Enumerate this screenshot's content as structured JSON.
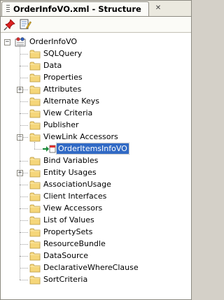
{
  "tab": {
    "title": "OrderInfoVO.xml - Structure"
  },
  "toolbar": {
    "pin_icon": "pin-icon",
    "edit_icon": "edit-properties-icon"
  },
  "tree": {
    "root": "OrderInfoVO",
    "items": [
      {
        "label": "SQLQuery",
        "expandable": false
      },
      {
        "label": "Data",
        "expandable": false
      },
      {
        "label": "Properties",
        "expandable": false
      },
      {
        "label": "Attributes",
        "expandable": true,
        "expanded": false
      },
      {
        "label": "Alternate Keys",
        "expandable": false
      },
      {
        "label": "View Criteria",
        "expandable": false
      },
      {
        "label": "Publisher",
        "expandable": false
      },
      {
        "label": "ViewLink Accessors",
        "expandable": true,
        "expanded": true
      },
      {
        "label": "Bind Variables",
        "expandable": false
      },
      {
        "label": "Entity Usages",
        "expandable": true,
        "expanded": false
      },
      {
        "label": "AssociationUsage",
        "expandable": false
      },
      {
        "label": "Client Interfaces",
        "expandable": false
      },
      {
        "label": "View Accessors",
        "expandable": false
      },
      {
        "label": "List of Values",
        "expandable": false
      },
      {
        "label": "PropertySets",
        "expandable": false
      },
      {
        "label": "ResourceBundle",
        "expandable": false
      },
      {
        "label": "DataSource",
        "expandable": false
      },
      {
        "label": "DeclarativeWhereClause",
        "expandable": false
      },
      {
        "label": "SortCriteria",
        "expandable": false
      }
    ],
    "child": {
      "label": "OrderItemsInfoVO",
      "selected": true
    }
  }
}
